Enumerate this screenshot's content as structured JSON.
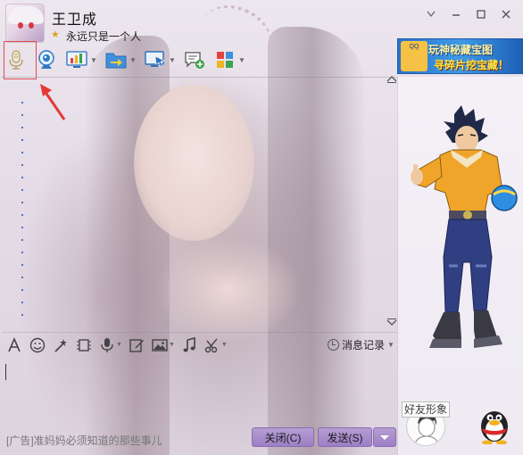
{
  "contact": {
    "name": "王卫成",
    "signature": "永远只是一个人"
  },
  "window_controls": {
    "menu": "▽",
    "minimize": "—",
    "maximize": "□",
    "close": "✕"
  },
  "toolbar": {
    "items": [
      {
        "name": "voice-call",
        "icon": "microphone-icon",
        "has_menu": false
      },
      {
        "name": "video-call",
        "icon": "webcam-icon",
        "has_menu": false
      },
      {
        "name": "remote-assist",
        "icon": "chart-icon",
        "has_menu": true
      },
      {
        "name": "send-file",
        "icon": "folder-arrow-icon",
        "has_menu": true
      },
      {
        "name": "share-screen",
        "icon": "monitor-arrow-icon",
        "has_menu": true
      },
      {
        "name": "create-discussion",
        "icon": "chat-add-icon",
        "has_menu": false
      },
      {
        "name": "apps",
        "icon": "apps-grid-icon",
        "has_menu": true
      }
    ]
  },
  "ad_banner": {
    "logo_text": "QQ",
    "line1": "玩神秘藏宝图",
    "line2": "寻碎片挖宝藏！"
  },
  "input_toolbar": {
    "history_label": "消息记录"
  },
  "bottom": {
    "ad_text": "[广告]准妈妈必须知道的那些事儿",
    "close_button": "关闭(C)",
    "send_button": "发送(S)"
  },
  "right_panel": {
    "friend_show_label": "好友形象"
  },
  "colors": {
    "button_purple": "#a68ac9",
    "highlight_red": "#e24b4b",
    "accent_blue": "#2a74c9"
  }
}
